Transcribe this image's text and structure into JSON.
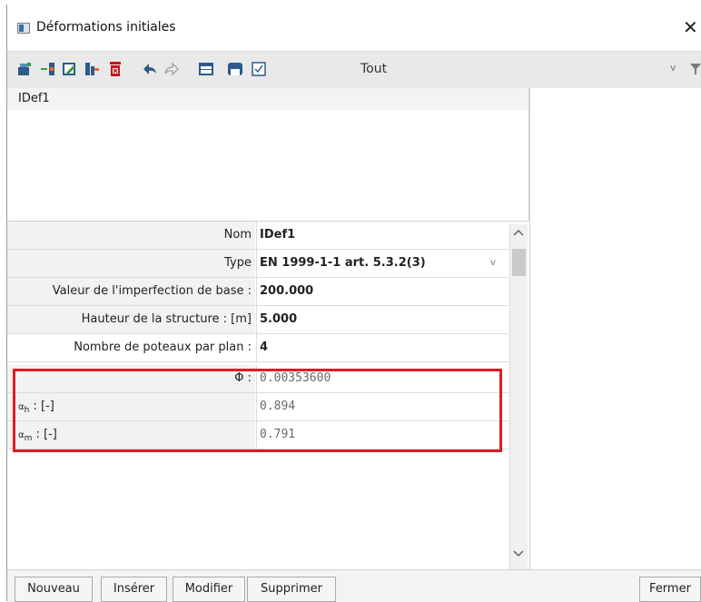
{
  "window": {
    "title": "Déformations initiales",
    "close_glyph": "✕"
  },
  "toolbar": {
    "icons": [
      "new-icon",
      "insert-icon",
      "edit-icon",
      "copy-icon",
      "delete-icon",
      "undo-icon",
      "redo-icon",
      "table-icon",
      "save-icon",
      "check-icon"
    ],
    "filter_label": "Tout",
    "chevron_glyph": "v"
  },
  "list": {
    "items": [
      "IDef1"
    ]
  },
  "properties": {
    "nom": {
      "label": "Nom",
      "value": "IDef1"
    },
    "type": {
      "label": "Type",
      "value": "EN 1999-1-1 art. 5.3.2(3)"
    },
    "base_imperfection": {
      "label": "Valeur de l'imperfection de base :",
      "value": "200.000"
    },
    "structure_height": {
      "label": "Hauteur de la structure : [m]",
      "value": "5.000"
    },
    "columns_per_plane": {
      "label": "Nombre de poteaux par plan :",
      "value": "4"
    },
    "phi": {
      "label": "Φ :",
      "value": "0.00353600"
    },
    "alpha_h": {
      "symbol": "α",
      "sub": "h",
      "unit": " : [-]",
      "value": "0.894"
    },
    "alpha_m": {
      "symbol": "α",
      "sub": "m",
      "unit": " : [-]",
      "value": "0.791"
    }
  },
  "buttons": {
    "nouveau": "Nouveau",
    "inserer": "Insérer",
    "modifier": "Modifier",
    "supprimer": "Supprimer",
    "fermer": "Fermer"
  },
  "colors": {
    "highlight": "#e01b24",
    "toolbar_bg": "#e9e9e9"
  }
}
